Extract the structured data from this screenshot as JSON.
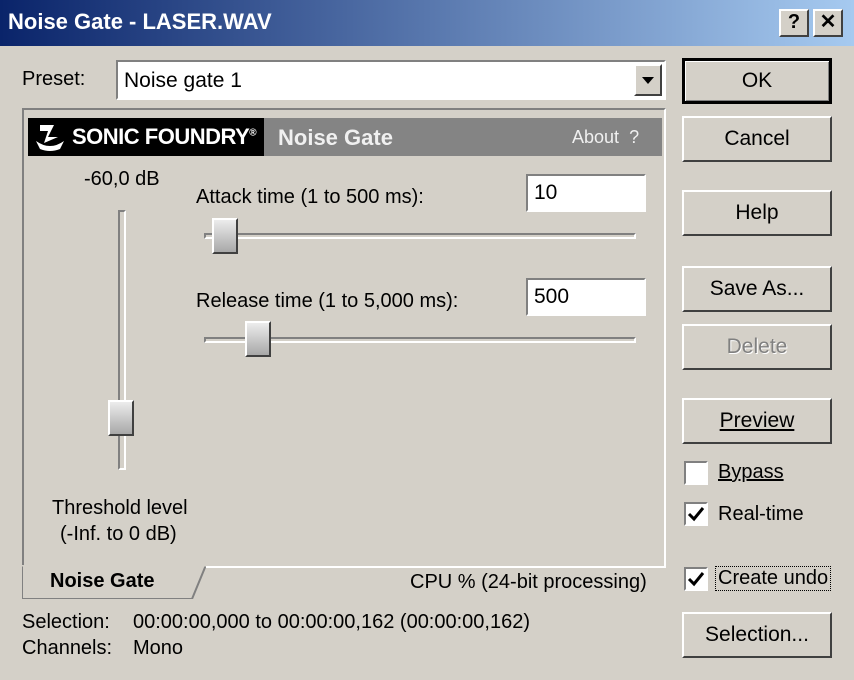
{
  "window": {
    "title": "Noise Gate - LASER.WAV",
    "help_btn": "?",
    "close_btn": "✕"
  },
  "preset": {
    "label": "Preset:",
    "value": "Noise gate 1"
  },
  "header": {
    "brand": "SONIC FOUNDRY",
    "reg": "®",
    "plugin_name": "Noise Gate",
    "about": "About",
    "about_q": "?"
  },
  "threshold": {
    "value_text": "-60,0 dB",
    "label1": "Threshold level",
    "label2": "(-Inf. to 0 dB)",
    "level_fraction": 0.15
  },
  "attack": {
    "label": "Attack time (1 to 500 ms):",
    "value": "10",
    "slider_fraction": 0.02
  },
  "release": {
    "label": "Release time (1 to 5,000 ms):",
    "value": "500",
    "slider_fraction": 0.1
  },
  "tab": {
    "label": "Noise Gate"
  },
  "status": {
    "cpu": "CPU %  (24-bit processing)"
  },
  "selection": {
    "label": "Selection:",
    "value": "00:00:00,000 to 00:00:00,162 (00:00:00,162)"
  },
  "channels": {
    "label": "Channels:",
    "value": "Mono"
  },
  "buttons": {
    "ok": "OK",
    "cancel": "Cancel",
    "help": "Help",
    "save_as": "Save As...",
    "delete": "Delete",
    "preview": "Preview",
    "selection": "Selection..."
  },
  "checkboxes": {
    "bypass": {
      "label": "Bypass",
      "checked": false
    },
    "realtime": {
      "label": "Real-time",
      "checked": true
    },
    "create_undo": {
      "label": "Create undo",
      "checked": true
    }
  },
  "colors": {
    "title_start": "#0a246a",
    "title_end": "#a6caf0",
    "face": "#d4d0c8",
    "header_bar": "#848484"
  }
}
